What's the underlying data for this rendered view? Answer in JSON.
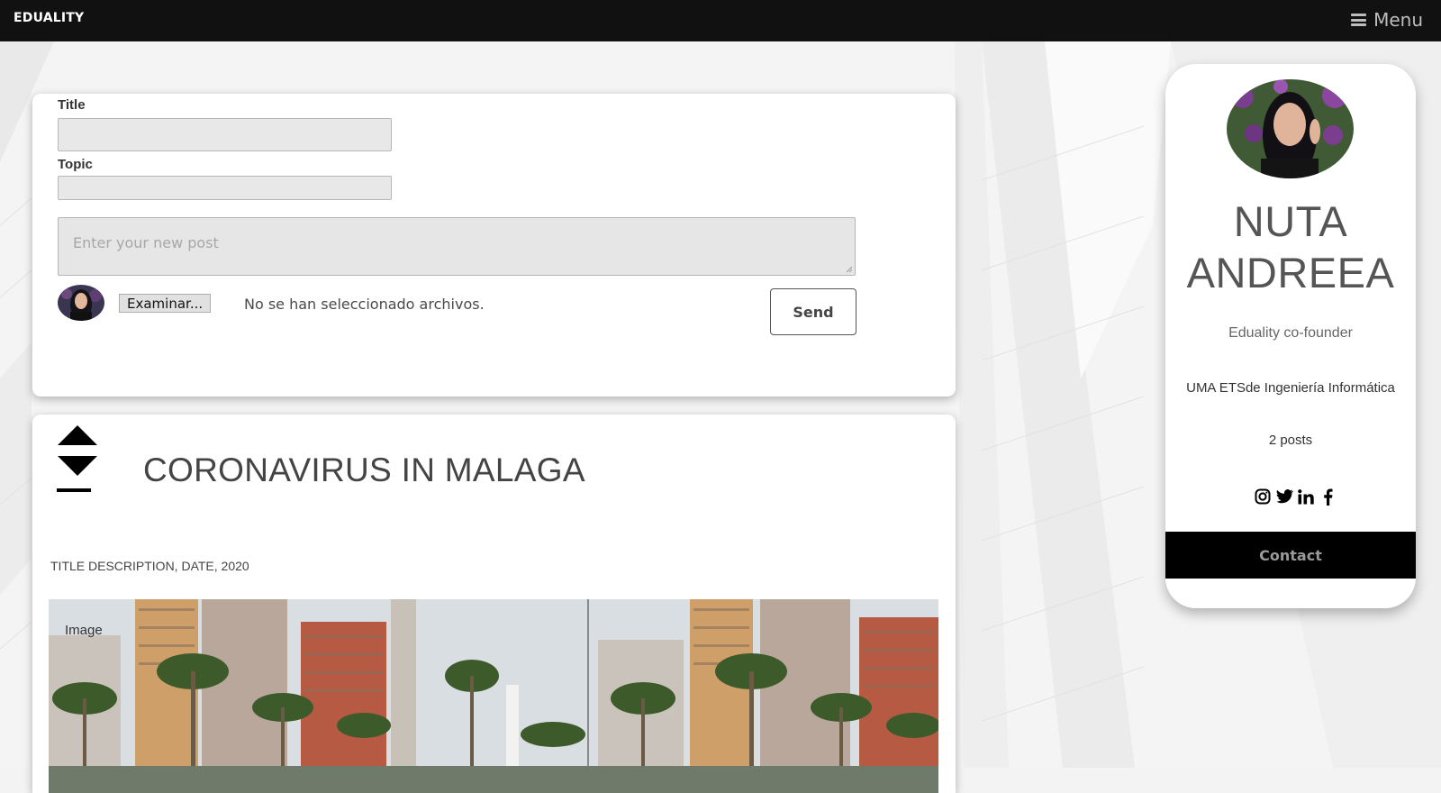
{
  "nav": {
    "brand": "EDUALITY",
    "menu_label": "Menu"
  },
  "post_form": {
    "title_label": "Title",
    "title_value": "",
    "topic_label": "Topic",
    "topic_value": "",
    "content_placeholder": "Enter your new post",
    "file_button_label": "Examinar...",
    "file_status": "No se han seleccionado archivos.",
    "send_label": "Send"
  },
  "post": {
    "title": "CORONAVIRUS IN MALAGA",
    "description": "TITLE DESCRIPTION, DATE, 2020",
    "image_caption": "Image"
  },
  "profile": {
    "name": "NUTA ANDREEA",
    "role": "Eduality co-founder",
    "school": "UMA ETSde Ingeniería Informática",
    "posts": "2 posts",
    "socials": [
      "instagram-icon",
      "twitter-icon",
      "linkedin-icon",
      "facebook-icon"
    ],
    "contact_label": "Contact"
  },
  "colors": {
    "topbar": "#111111",
    "page_background": "#f3f3f3",
    "card": "#ffffff",
    "contact_button": "#000000"
  }
}
